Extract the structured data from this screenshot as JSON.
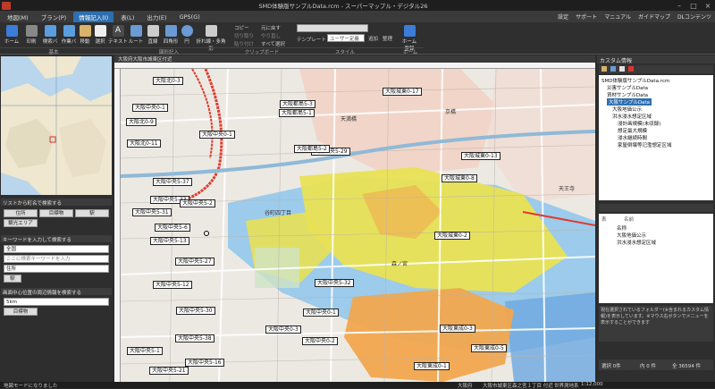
{
  "window": {
    "title": "SMD体験版サンプルData.rcm - スーパーマップル・デジタル26"
  },
  "menu": {
    "tabs": [
      "地図(M)",
      "ブラン(P)",
      "情報記入(I)",
      "表(L)",
      "出力(E)",
      "GPS(G)"
    ],
    "right": [
      "設定",
      "サポート",
      "マニュアル",
      "ガイドマップ",
      "DLコンテンツ"
    ]
  },
  "ribbon": {
    "buttons": [
      "ホーム",
      "印刷",
      "検索バー",
      "作業バー",
      "移動",
      "選択",
      "テキスト",
      "ルート",
      "直線",
      "四角形",
      "円",
      "折れ線・多角形"
    ],
    "clipboard": [
      "コピー",
      "切り取り",
      "貼り付け",
      "元に戻す",
      "やり直し",
      "すべて選択"
    ],
    "style": {
      "template_label": "テンプレート",
      "template_value": "ユーザー定義",
      "add": "追加",
      "arrange": "整理"
    },
    "home_button": "ホーム登録",
    "groups": [
      "基本",
      "図形記入",
      "クリップボード",
      "スタイル",
      "ホーム"
    ]
  },
  "left": {
    "list_search_title": "リストから町名で検索する",
    "list_buttons": [
      "住所",
      "目標物",
      "駅"
    ],
    "sightseeing": "観光エリア",
    "keyword_title": "キーワードを入力して検索する",
    "keyword_category": "全国",
    "keyword_placeholder": "ここに検索キーワードを入力",
    "keyword_sub": "住所",
    "keyword_button": "駅",
    "nearby_title": "画面中心位置の周辺情報を検索する",
    "nearby_distance": "5km",
    "nearby_target": "目標物"
  },
  "map": {
    "tab": "大阪府大阪市城東区付近",
    "labels": [
      "大阪北0-3",
      "大阪中央0-1",
      "大阪北0-9",
      "大阪北0-11",
      "大阪中央0-1",
      "大阪都島5-3",
      "大阪都島5-1",
      "大阪城東0-17",
      "大阪城東0-13",
      "大阪城東0-8",
      "大阪中央5-37",
      "大阪中央5-31",
      "大阪中央5-33",
      "大阪中央5-27",
      "大阪中央5-29",
      "大阪中央5-6",
      "大阪中央5-32",
      "大阪中央5-12",
      "大阪中央5-30",
      "大阪中央5-38",
      "大阪中央0-3",
      "大阪中央5-16",
      "大阪中央5-21",
      "大阪中央0-1",
      "大阪中央0-2",
      "大阪城東0-2",
      "大阪東成0-3",
      "大阪東成0-5",
      "大阪東成0-1",
      "大阪中央5-2",
      "大阪中央5-13",
      "大阪都島5-2",
      "大阪中央5-1"
    ],
    "place_names": [
      "天満橋",
      "谷町四丁目",
      "森ノ宮",
      "京橋",
      "天王寺"
    ]
  },
  "right": {
    "header": "カスタム情報",
    "tree": [
      "SMD体験版サンプルData.rcm",
      "災害サンプルData",
      "資材サンプルData",
      "大阪サンプルData",
      "大阪地価公示",
      "洪水浸水想定区域",
      "浸計画規模(未収録)",
      "想定最大規模",
      "浸水継続時間",
      "家屋倒壊等氾濫想定区域"
    ],
    "legend_cols": [
      "表",
      "名前"
    ],
    "legend_rows": [
      "名称",
      "大阪地価公示",
      "洪水浸水想定区域"
    ],
    "hint": "現在選択されているフォルダー(※含まれるカスタム情報)を表示しています。※マウス右ボタンでメニューを表示することができます",
    "count_label": "選択 0件",
    "count_total": "全 36594 件",
    "count_inner": "内 0 件"
  },
  "status": {
    "left": "地図モードになりました",
    "pref": "大阪府",
    "address": "大阪市城東区森之宮１丁目 付近",
    "datum": "世界測地系",
    "scale": "1:12,000"
  },
  "colors": {
    "flood_yellow": "#e9e154",
    "flood_blue": "#8ec5ec",
    "flood_orange": "#f2a64e",
    "accent_tab": "#2d6fb0",
    "rail_red": "#e03b2e"
  }
}
